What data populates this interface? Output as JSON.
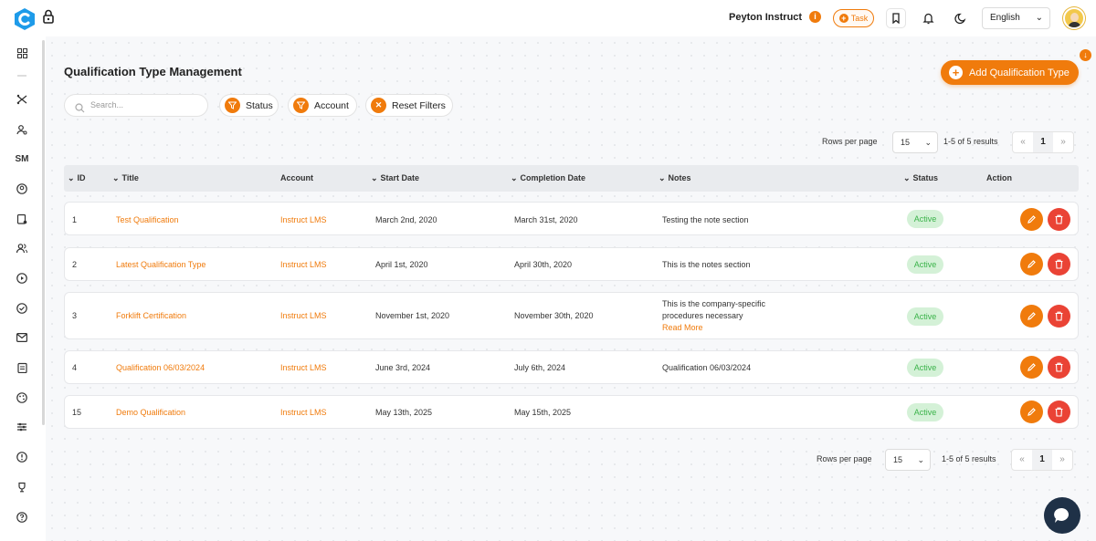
{
  "header": {
    "user_name": "Peyton Instruct",
    "info_badge": "i",
    "task_label": "Task",
    "language": "English"
  },
  "page": {
    "title": "Qualification Type Management",
    "add_button": "Add Qualification Type"
  },
  "filters": {
    "search_placeholder": "Search...",
    "status_label": "Status",
    "account_label": "Account",
    "reset_label": "Reset Filters"
  },
  "pagination": {
    "rows_label": "Rows per page",
    "rows_value": "15",
    "range": "1-5 of 5 results",
    "prev": "«",
    "current_page": "1",
    "next": "»"
  },
  "table": {
    "columns": {
      "id": "ID",
      "title": "Title",
      "account": "Account",
      "start": "Start Date",
      "completion": "Completion Date",
      "notes": "Notes",
      "status": "Status",
      "action": "Action"
    },
    "rows": [
      {
        "id": "1",
        "title": "Test Qualification",
        "account": "Instruct LMS",
        "start": "March 2nd, 2020",
        "completion": "March 31st, 2020",
        "notes": "Testing the note section",
        "more": "",
        "status": "Active"
      },
      {
        "id": "2",
        "title": "Latest Qualification Type",
        "account": "Instruct LMS",
        "start": "April 1st, 2020",
        "completion": "April 30th, 2020",
        "notes": "This is the notes section",
        "more": "",
        "status": "Active"
      },
      {
        "id": "3",
        "title": "Forklift Certification",
        "account": "Instruct LMS",
        "start": "November 1st, 2020",
        "completion": "November 30th, 2020",
        "notes": "This is the company-specific procedures necessary",
        "more": "Read More",
        "status": "Active"
      },
      {
        "id": "4",
        "title": "Qualification 06/03/2024",
        "account": "Instruct LMS",
        "start": "June 3rd, 2024",
        "completion": "July 6th, 2024",
        "notes": "Qualification 06/03/2024",
        "more": "",
        "status": "Active"
      },
      {
        "id": "15",
        "title": "Demo Qualification",
        "account": "Instruct LMS",
        "start": "May 13th, 2025",
        "completion": "May 15th, 2025",
        "notes": "",
        "more": "",
        "status": "Active"
      }
    ]
  },
  "sidebar": {
    "sm_label": "SM"
  },
  "colors": {
    "accent": "#f07b0c",
    "danger": "#ea4335",
    "active_bg": "#d4f1d7",
    "active_text": "#3bb34a"
  }
}
